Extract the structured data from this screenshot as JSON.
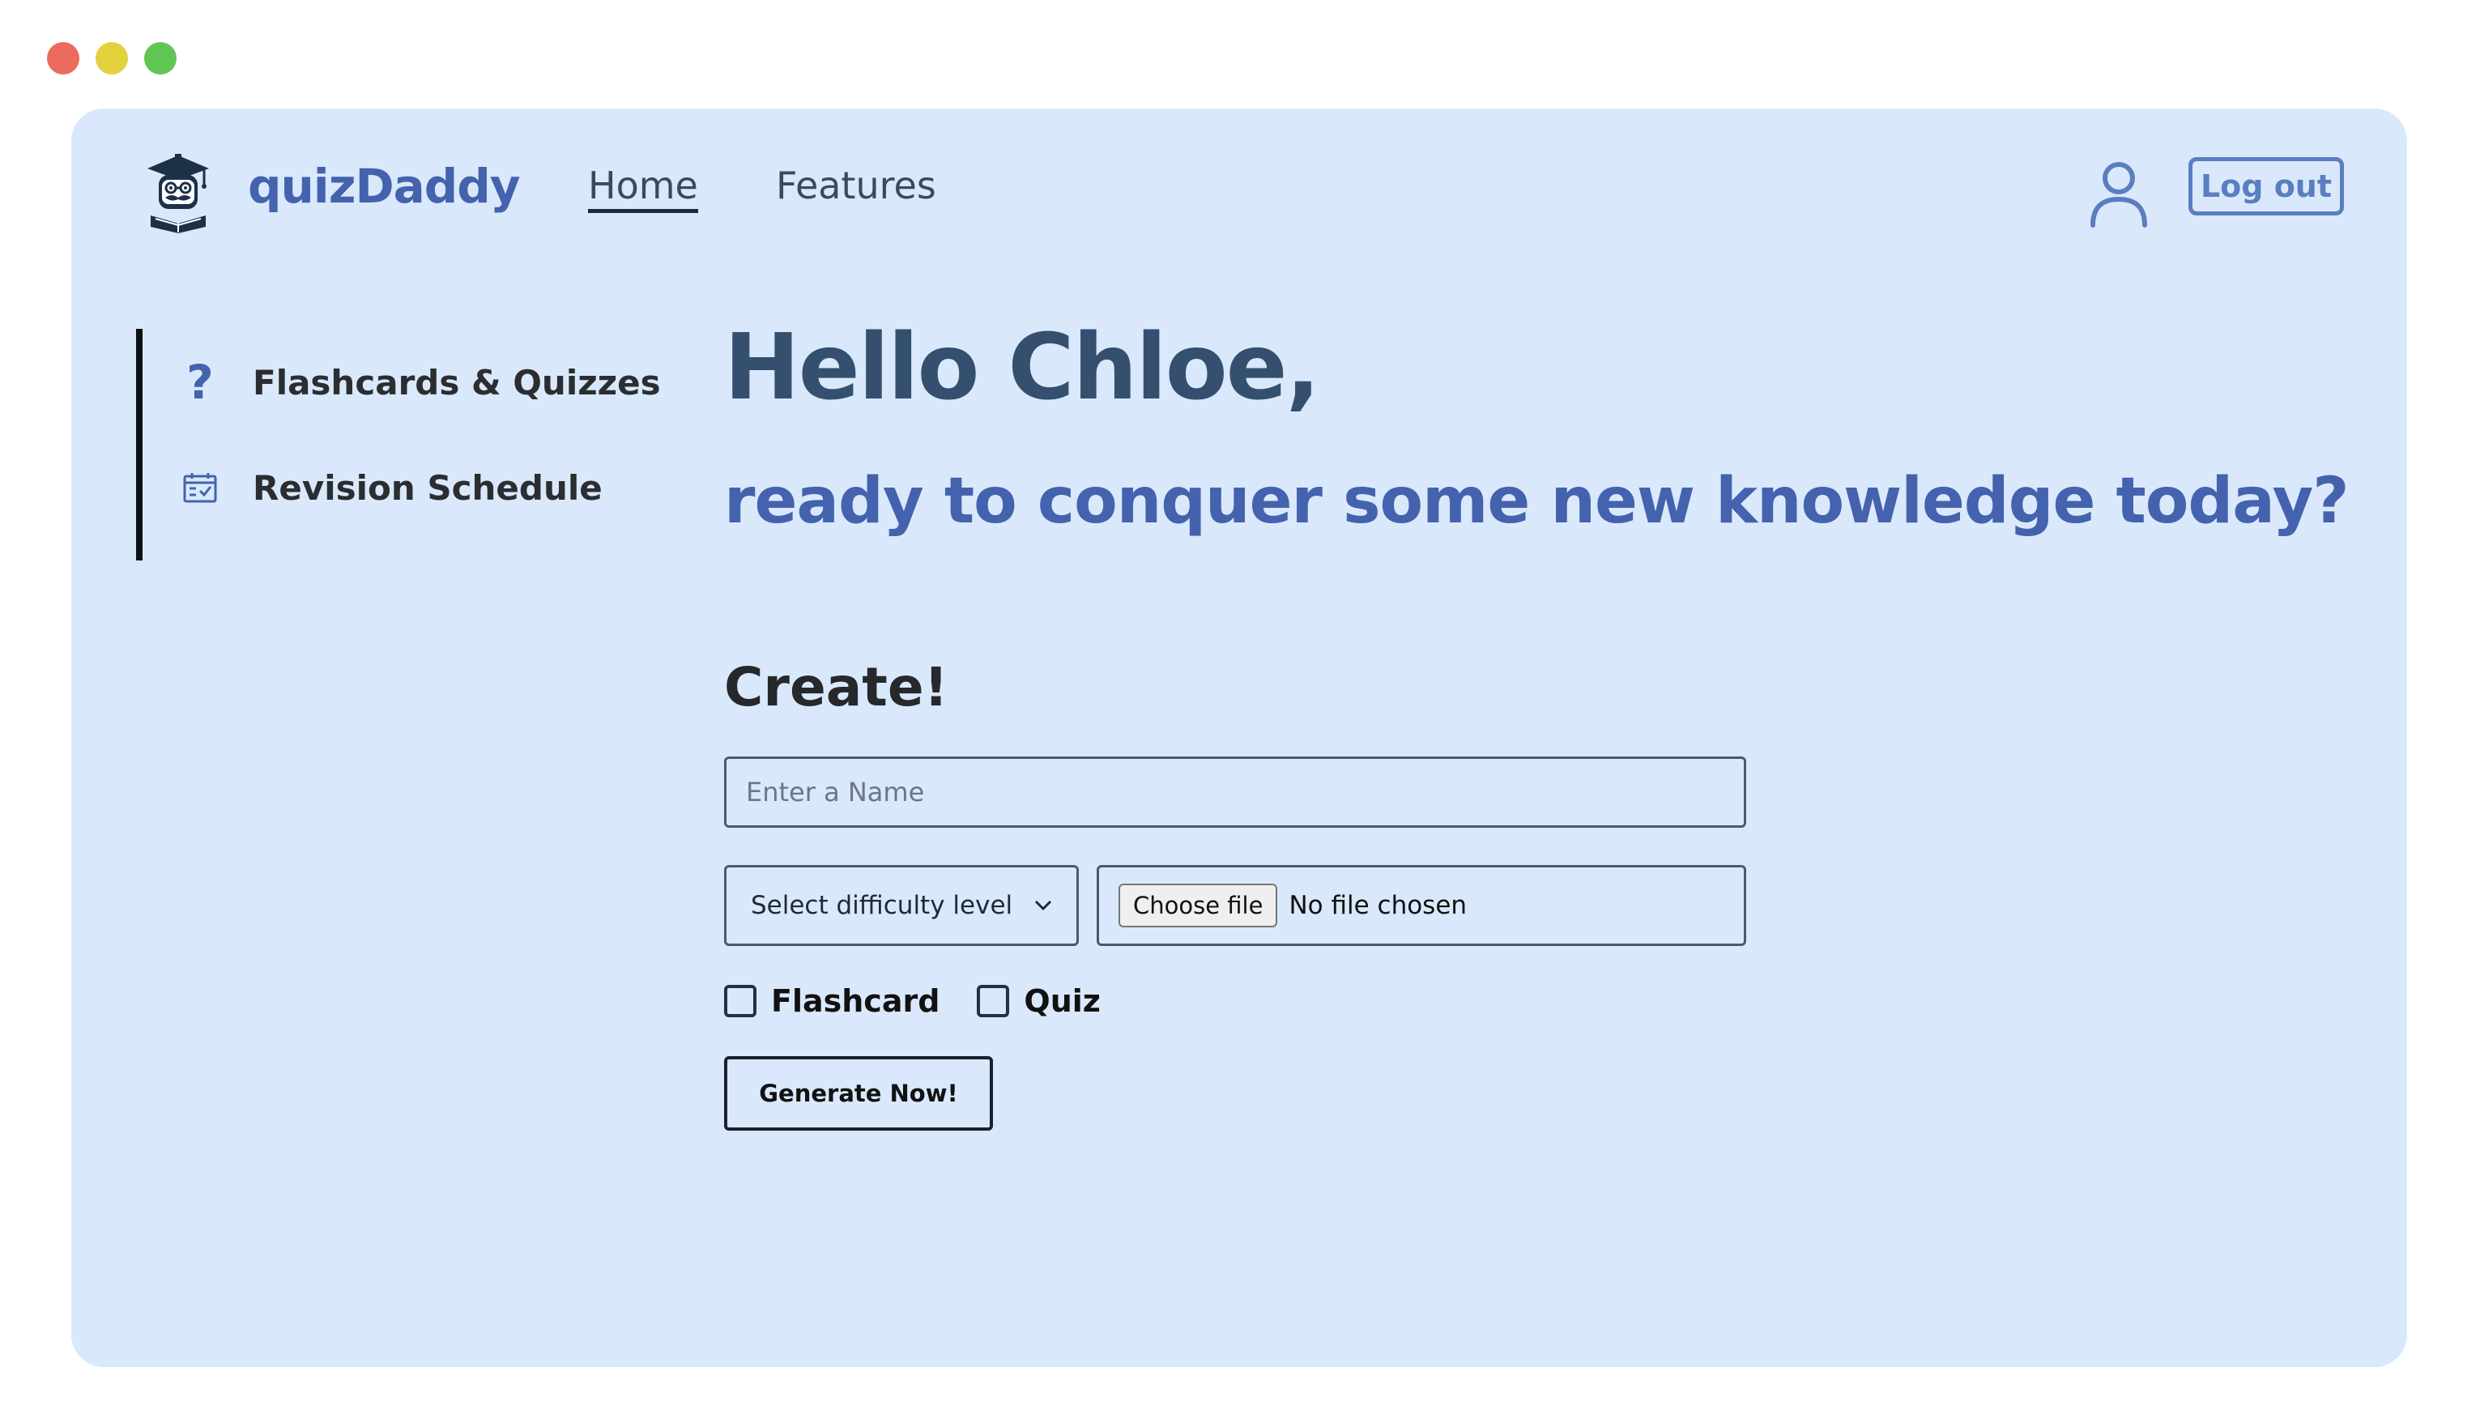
{
  "window": {
    "dots": [
      {
        "name": "close-dot",
        "color": "#ed6a5e"
      },
      {
        "name": "minimize-dot",
        "color": "#e3d13d"
      },
      {
        "name": "maximize-dot",
        "color": "#61c554"
      }
    ]
  },
  "theme": {
    "app_bg": "#d9e9fb",
    "brand_color": "#4462ad",
    "dark_blue": "#35506f",
    "accent_blue": "#4462ad",
    "sidebar_text": "#2b2d31"
  },
  "header": {
    "brand": "quizDaddy",
    "logo_icon": "graduate-mascot-icon",
    "nav": {
      "home": "Home",
      "features": "Features"
    },
    "user_icon": "user-icon",
    "logout_label": "Log out"
  },
  "sidebar": {
    "items": [
      {
        "label": "Flashcards & Quizzes",
        "icon": "question-icon"
      },
      {
        "label": "Revision Schedule",
        "icon": "calendar-check-icon"
      }
    ]
  },
  "main": {
    "greeting": "Hello Chloe,",
    "tagline": "ready to conquer some new knowledge today?",
    "create": {
      "title": "Create!",
      "name_placeholder": "Enter a Name",
      "difficulty_selected": "Select difficulty level",
      "choose_file_label": "Choose file",
      "file_status": "No file chosen",
      "checkboxes": [
        {
          "label": "Flashcard",
          "checked": false
        },
        {
          "label": "Quiz",
          "checked": false
        }
      ],
      "generate_label": "Generate Now!"
    }
  }
}
